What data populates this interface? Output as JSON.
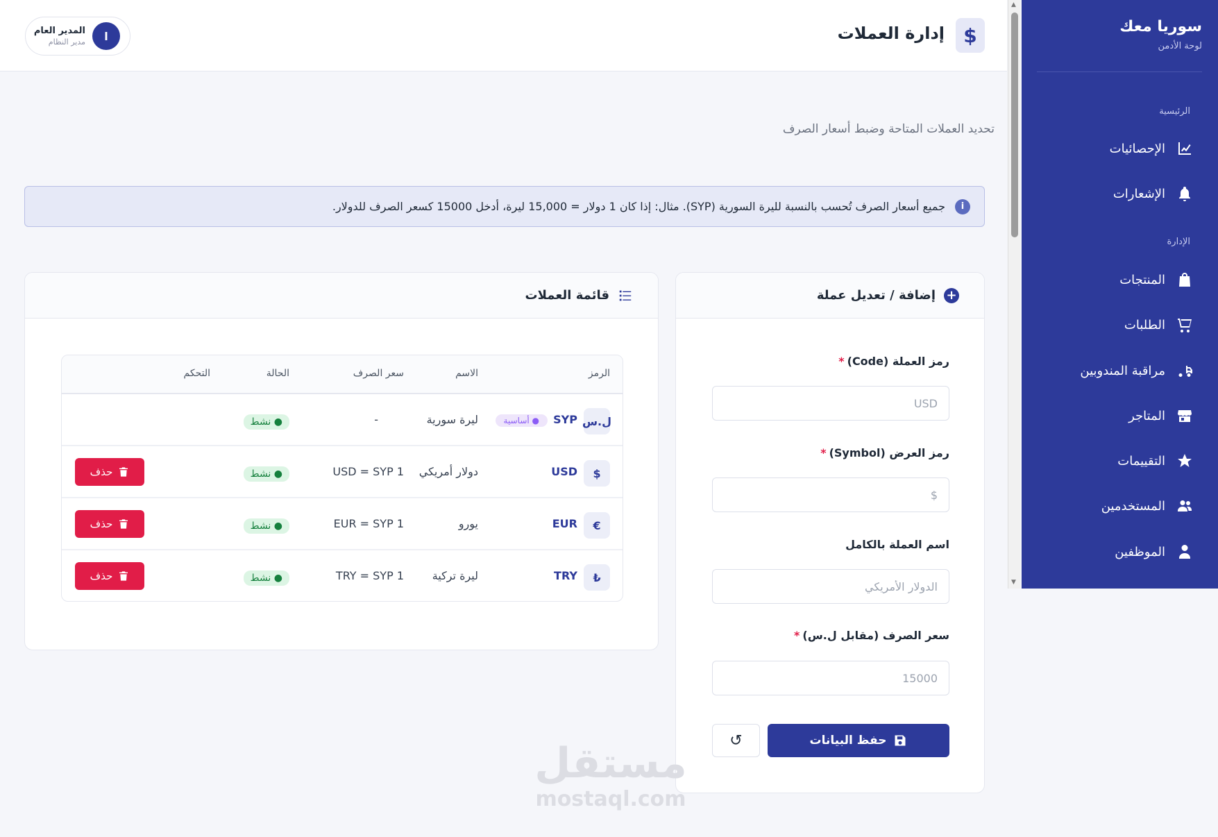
{
  "sidebar": {
    "brand_title": "سوريا معك",
    "brand_sub": "لوحة الأدمن",
    "section_main": "الرئيسية",
    "section_admin": "الإدارة",
    "items": [
      {
        "label": "الإحصائيات",
        "icon": "chart-line-icon"
      },
      {
        "label": "الإشعارات",
        "icon": "bell-icon"
      },
      {
        "label": "المنتجات",
        "icon": "shopping-bag-icon"
      },
      {
        "label": "الطلبات",
        "icon": "cart-icon"
      },
      {
        "label": "مراقبة المندوبين",
        "icon": "truck-icon"
      },
      {
        "label": "المتاجر",
        "icon": "store-icon"
      },
      {
        "label": "التقييمات",
        "icon": "star-icon"
      },
      {
        "label": "المستخدمين",
        "icon": "users-icon"
      },
      {
        "label": "الموظفين",
        "icon": "user-tie-icon"
      }
    ]
  },
  "header": {
    "title": "إدارة العملات",
    "icon_symbol": "$",
    "user_name": "المدير العام",
    "user_role": "مدير النظام",
    "avatar_initial": "ا"
  },
  "subtitle": "تحديد العملات المتاحة وضبط أسعار الصرف",
  "info_alert": "جميع أسعار الصرف تُحسب بالنسبة لليرة السورية (SYP). مثال: إذا كان 1 دولار = 15,000 ليرة، أدخل 15000 كسعر الصرف للدولار.",
  "form": {
    "title": "إضافة / تعديل عملة",
    "code_label": "رمز العملة (Code)",
    "code_placeholder": "USD",
    "symbol_label": "رمز العرض (Symbol)",
    "symbol_placeholder": "$",
    "name_label": "اسم العملة بالكامل",
    "name_placeholder": "الدولار الأمريكي",
    "rate_label": "سعر الصرف (مقابل ل.س)",
    "rate_placeholder": "15000",
    "required_mark": "*",
    "save_label": "حفظ البيانات",
    "reset_symbol": "↺"
  },
  "list": {
    "title": "قائمة العملات",
    "columns": {
      "code": "الرمز",
      "name": "الاسم",
      "rate": "سعر الصرف",
      "status": "الحالة",
      "actions": "التحكم"
    },
    "base_label": "● أساسية",
    "delete_label": "حذف",
    "rows": [
      {
        "symbol": "ل.س",
        "code": "SYP",
        "name": "ليرة سورية",
        "rate": "-",
        "status": "● نشط"
      },
      {
        "symbol": "$",
        "code": "USD",
        "name": "دولار أمريكي",
        "rate": "1 USD = SYP",
        "status": "● نشط"
      },
      {
        "symbol": "€",
        "code": "EUR",
        "name": "يورو",
        "rate": "1 EUR = SYP",
        "status": "● نشط"
      },
      {
        "symbol": "₺",
        "code": "TRY",
        "name": "ليرة تركية",
        "rate": "1 TRY = SYP",
        "status": "● نشط"
      }
    ]
  },
  "watermark": {
    "ar": "مستقل",
    "en": "mostaql.com"
  },
  "colors": {
    "primary": "#2d3a9a",
    "danger": "#e11d48",
    "success": "#15803d",
    "background": "#f5f6fa"
  }
}
